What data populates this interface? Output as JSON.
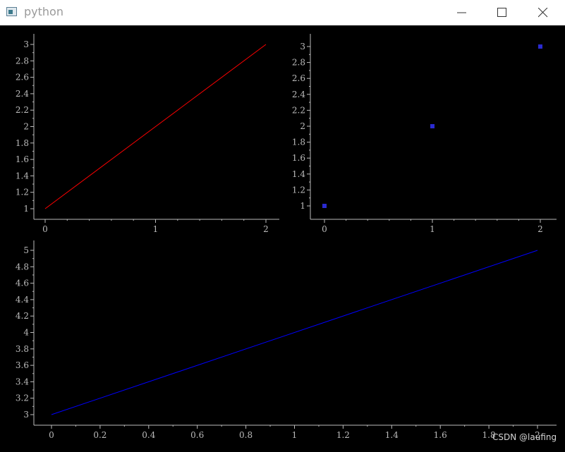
{
  "window": {
    "title": "python",
    "app_icon": "window-app-icon",
    "controls": [
      "minimize-icon",
      "maximize-icon",
      "close-icon"
    ]
  },
  "watermark": "CSDN @laufing",
  "colors": {
    "background": "#000000",
    "axis": "#bbbbbb",
    "tick_text": "#bbbbbb",
    "red": "#ff0000",
    "blue": "#0000ff",
    "point": "#2a2ad0"
  },
  "chart_data": [
    {
      "type": "line",
      "x": [
        0,
        1,
        2
      ],
      "y": [
        1,
        2,
        3
      ],
      "color": "red",
      "xticks": [
        "0",
        "1",
        "2"
      ],
      "yticks": [
        "1",
        "1.2",
        "1.4",
        "1.6",
        "1.8",
        "2",
        "2.2",
        "2.4",
        "2.6",
        "2.8",
        "3"
      ],
      "xlim": [
        -0.1,
        2.1
      ],
      "ylim": [
        0.9,
        3.1
      ],
      "grid": false
    },
    {
      "type": "scatter",
      "x": [
        0,
        1,
        2
      ],
      "y": [
        1,
        2,
        3
      ],
      "color": "blue",
      "marker": "square",
      "xticks": [
        "0",
        "1",
        "2"
      ],
      "yticks": [
        "1",
        "1.2",
        "1.4",
        "1.6",
        "1.8",
        "2",
        "2.2",
        "2.4",
        "2.6",
        "2.8",
        "3"
      ],
      "xlim": [
        -0.1,
        2.1
      ],
      "ylim": [
        0.9,
        3.1
      ],
      "grid": false
    },
    {
      "type": "line",
      "x": [
        0,
        2
      ],
      "y": [
        3,
        5
      ],
      "color": "blue",
      "xticks": [
        "0",
        "0.2",
        "0.4",
        "0.6",
        "0.8",
        "1",
        "1.2",
        "1.4",
        "1.6",
        "1.8",
        "2"
      ],
      "yticks": [
        "3",
        "3.2",
        "3.4",
        "3.6",
        "3.8",
        "4",
        "4.2",
        "4.4",
        "4.6",
        "4.8",
        "5"
      ],
      "xlim": [
        -0.1,
        2.1
      ],
      "ylim": [
        2.9,
        5.1
      ],
      "grid": false
    }
  ]
}
